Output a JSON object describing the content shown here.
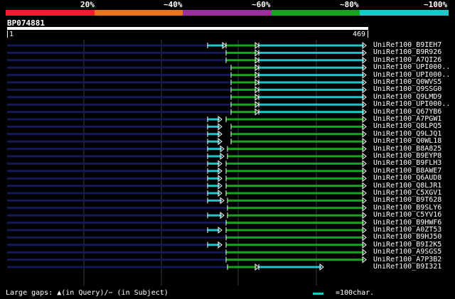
{
  "legend": {
    "segments": [
      {
        "color": "#e8222c"
      },
      {
        "color": "#e8751e"
      },
      {
        "color": "#9b2fa0"
      },
      {
        "color": "#14a41e"
      },
      {
        "color": "#1ec6c9"
      }
    ],
    "labels": [
      "20%",
      "~40%",
      "~60%",
      "~80%",
      "~100%"
    ]
  },
  "query": {
    "name": "BP074881",
    "start": "1",
    "end": "469"
  },
  "hits": [
    {
      "name": "UniRef100_B9IEH7"
    },
    {
      "name": "UniRef100_B9R926"
    },
    {
      "name": "UniRef100_A7QI26"
    },
    {
      "name": "UniRef100_UPI000.."
    },
    {
      "name": "UniRef100_UPI000.."
    },
    {
      "name": "UniRef100_Q0WVS5"
    },
    {
      "name": "UniRef100_Q9SSG0"
    },
    {
      "name": "UniRef100_Q9LMD9"
    },
    {
      "name": "UniRef100_UPI000.."
    },
    {
      "name": "UniRef100_Q67YB6"
    },
    {
      "name": "UniRef100_A7PGW1"
    },
    {
      "name": "UniRef100_Q8LPQ5"
    },
    {
      "name": "UniRef100_Q9LJQ1"
    },
    {
      "name": "UniRef100_Q0WL18"
    },
    {
      "name": "UniRef100_B8A825"
    },
    {
      "name": "UniRef100_B9EYP8"
    },
    {
      "name": "UniRef100_B9FLH3"
    },
    {
      "name": "UniRef100_B8AWE7"
    },
    {
      "name": "UniRef100_Q6AUD8"
    },
    {
      "name": "UniRef100_Q8LJR1"
    },
    {
      "name": "UniRef100_C5XGV1"
    },
    {
      "name": "UniRef100_B9T628"
    },
    {
      "name": "UniRef100_B9SLY6"
    },
    {
      "name": "UniRef100_C5YV16"
    },
    {
      "name": "UniRef100_B9HWF6"
    },
    {
      "name": "UniRef100_A0ZT53"
    },
    {
      "name": "UniRef100_B9HJ50"
    },
    {
      "name": "UniRef100_B9I2K5"
    },
    {
      "name": "UniRef100_A9SGS5"
    },
    {
      "name": "UniRef100_A7P3B2"
    },
    {
      "name": "UniRef100_B9I321"
    }
  ],
  "footer": {
    "gaps_text": "Large gaps: ▲(in Query)/− (in Subject)",
    "scale_text": "=100char."
  },
  "colors": {
    "cyan": "#1ec6c9",
    "green": "#14a41e",
    "navy": "#131a55",
    "grid": "#3a3a3a"
  }
}
